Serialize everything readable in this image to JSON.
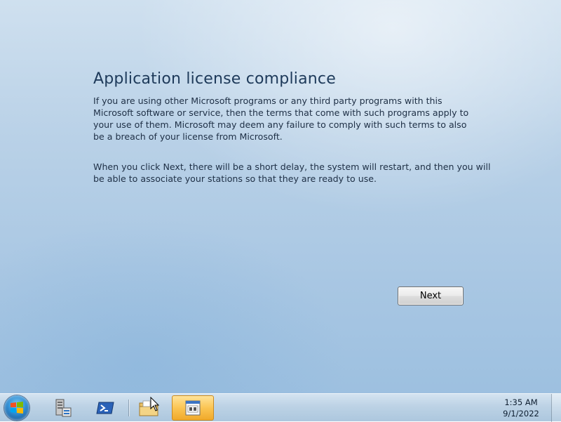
{
  "page": {
    "title": "Application license compliance",
    "paragraph1": "If you are using other Microsoft programs or any third party programs with this Microsoft software or service, then the terms that come with such programs apply to your use of them.  Microsoft may deem any failure to comply with such terms to also be a breach of your license from Microsoft.",
    "paragraph2": "When you click Next, there will be a short delay, the system will restart, and then you will be able to associate your stations so that they are ready to use.",
    "next_label": "Next"
  },
  "taskbar": {
    "items": [
      {
        "icon": "windows-start-icon"
      },
      {
        "icon": "server-manager-icon"
      },
      {
        "icon": "powershell-icon"
      },
      {
        "icon": "folder-icon"
      },
      {
        "icon": "application-window-icon",
        "active": true
      }
    ],
    "clock": {
      "time": "1:35 AM",
      "date": "9/1/2022"
    }
  },
  "colors": {
    "title": "#1e3a5a",
    "text": "#1e2f45",
    "active_task": "#fbc553"
  }
}
